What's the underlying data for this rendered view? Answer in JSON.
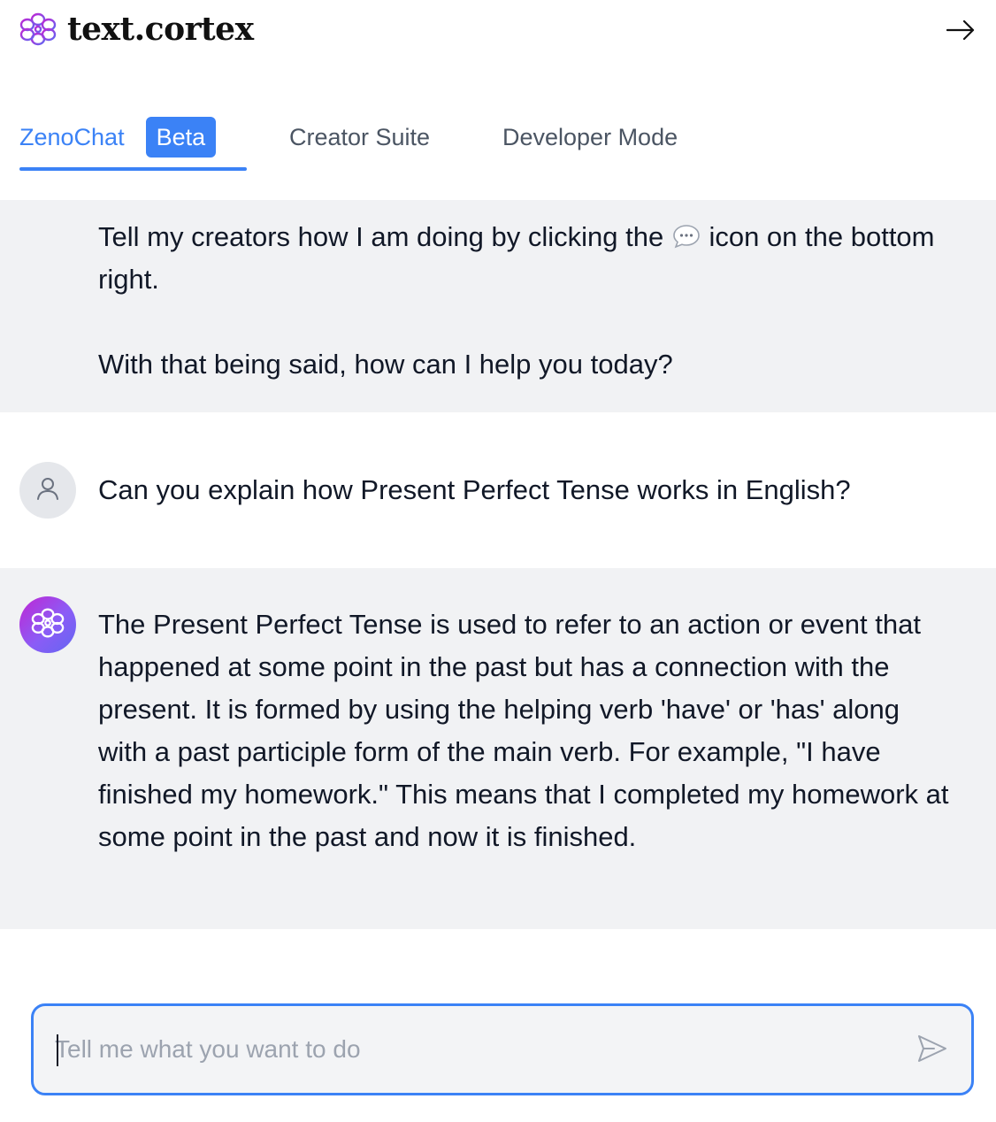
{
  "app": {
    "logo_text": "text.cortex"
  },
  "tabs": [
    {
      "label": "ZenoChat",
      "badge": "Beta",
      "active": true
    },
    {
      "label": "Creator Suite",
      "active": false
    },
    {
      "label": "Developer Mode",
      "active": false
    }
  ],
  "messages": [
    {
      "role": "assistant",
      "text_before_icon": "Tell my creators how I am doing by clicking the ",
      "inline_icon": "speech-bubble-icon",
      "text_after_icon": " icon on the bottom right.",
      "followup": "With that being said, how can I help you today?"
    },
    {
      "role": "user",
      "text": "Can you explain how Present Perfect Tense works in English?"
    },
    {
      "role": "assistant",
      "text": "The Present Perfect Tense is used to refer to an action or event that happened at some point in the past but has a connection with the present. It is formed by using the helping verb 'have' or 'has' along with a past participle form of the main verb. For example, \"I have finished my homework.\" This means that I completed my homework at some point in the past and now it is finished."
    }
  ],
  "composer": {
    "placeholder": "Tell me what you want to do",
    "value": ""
  },
  "colors": {
    "accent": "#3b82f6",
    "message_bg": "#f1f2f4",
    "logo_gradient_start": "#c026d3",
    "logo_gradient_end": "#6366f1"
  },
  "icons": {
    "logo": "brain-flower-icon",
    "collapse": "arrow-right-icon",
    "user_avatar": "user-icon",
    "bot_avatar": "brain-flower-icon",
    "send": "send-icon"
  }
}
